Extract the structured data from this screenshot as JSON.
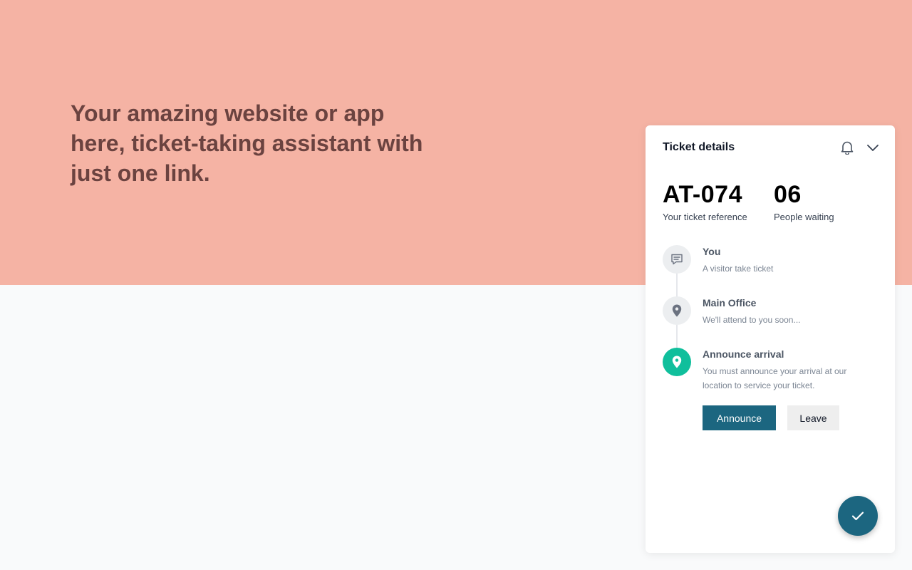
{
  "hero": {
    "headline": "Your amazing website or app here, ticket-taking assistant with just one link."
  },
  "panel": {
    "title": "Ticket details",
    "icons": {
      "notifications": "bell-icon",
      "collapse": "chevron-down-icon"
    },
    "ticket_reference": {
      "value": "AT-074",
      "label": "Your ticket reference"
    },
    "people_waiting": {
      "value": "06",
      "label": "People waiting"
    },
    "steps": [
      {
        "title": "You",
        "description": "A visitor take ticket",
        "icon": "chat-icon"
      },
      {
        "title": "Main Office",
        "description": "We'll attend to you soon...",
        "icon": "location-pin-icon"
      },
      {
        "title": "Announce arrival",
        "description": "You must announce your arrival at our location to service your ticket.",
        "icon": "location-pin-icon"
      }
    ],
    "announce_label": "Announce",
    "leave_label": "Leave",
    "fab_icon": "check-icon"
  },
  "colors": {
    "hero_background": "#f5b3a4",
    "hero_text": "#6b4340",
    "primary": "#1c6680",
    "active_step": "#10bf9c"
  }
}
